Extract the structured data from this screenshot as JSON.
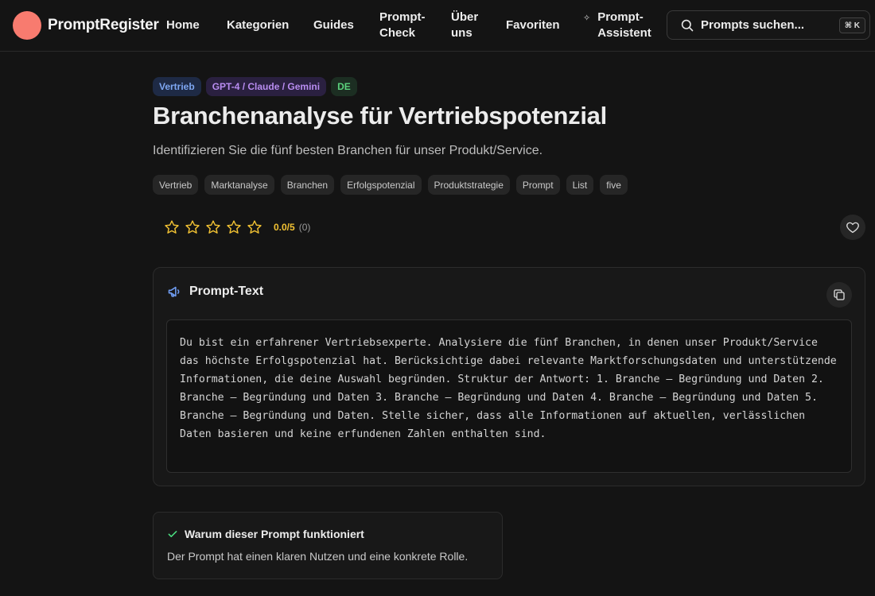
{
  "header": {
    "logo": "PromptRegister",
    "nav": {
      "home": "Home",
      "categories": "Kategorien",
      "guides": "Guides",
      "prompt_check_line1": "Prompt-",
      "prompt_check_line2": "Check",
      "about_line1": "Über",
      "about_line2": "uns",
      "favorites": "Favoriten",
      "assistant_line1": "Prompt-",
      "assistant_line2": "Assistent"
    },
    "search": {
      "placeholder": "Prompts suchen...",
      "shortcut": "⌘ K"
    }
  },
  "prompt": {
    "badges": {
      "category": "Vertrieb",
      "models": "GPT-4 / Claude / Gemini",
      "language": "DE"
    },
    "title": "Branchenanalyse für Vertriebspotenzial",
    "subtitle": "Identifizieren Sie die fünf besten Branchen für unser Produkt/Service.",
    "tags": [
      "Vertrieb",
      "Marktanalyse",
      "Branchen",
      "Erfolgspotenzial",
      "Produktstrategie",
      "Prompt",
      "List",
      "five"
    ],
    "rating": {
      "score": "0.0/5",
      "count": "(0)",
      "value": 0,
      "max": 5
    },
    "text_section": {
      "heading": "Prompt-Text",
      "body": "Du bist ein erfahrener Vertriebsexperte. Analysiere die fünf Branchen, in denen unser Produkt/Service das höchste Erfolgspotenzial hat. Berücksichtige dabei relevante Marktforschungsdaten und unterstützende Informationen, die deine Auswahl begründen. Struktur der Antwort: 1. Branche – Begründung und Daten 2. Branche – Begründung und Daten 3. Branche – Begründung und Daten 4. Branche – Begründung und Daten 5. Branche – Begründung und Daten. Stelle sicher, dass alle Informationen auf aktuellen, verlässlichen Daten basieren und keine erfundenen Zahlen enthalten sind."
    },
    "why": {
      "heading": "Warum dieser Prompt funktioniert",
      "text": "Der Prompt hat einen klaren Nutzen und eine konkrete Rolle."
    }
  },
  "colors": {
    "logo": "#f87b6f",
    "star": "#f2c233",
    "category_badge": "#7ea7f2",
    "model_badge": "#b88cf0",
    "language_badge": "#5bd37d",
    "check": "#4ade80"
  },
  "icons": {
    "search": "search-icon",
    "sparkle": "sparkle-icon",
    "star": "star-outline-icon",
    "favorite": "heart-icon",
    "prompt_heading": "megaphone-icon",
    "copy": "copy-icon",
    "why": "check-icon"
  }
}
